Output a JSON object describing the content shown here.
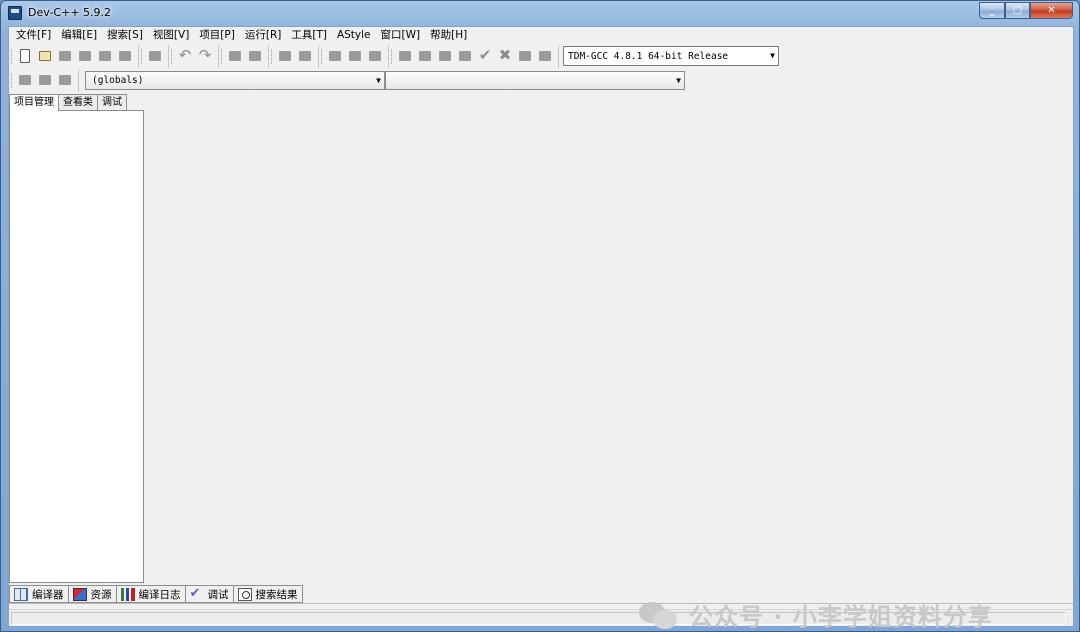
{
  "window": {
    "title": "Dev-C++ 5.9.2"
  },
  "menu": [
    "文件[F]",
    "编辑[E]",
    "搜索[S]",
    "视图[V]",
    "项目[P]",
    "运行[R]",
    "工具[T]",
    "AStyle",
    "窗口[W]",
    "帮助[H]"
  ],
  "toolbar": {
    "compiler": "TDM-GCC 4.8.1 64-bit Release",
    "scope": "(globals)",
    "member": ""
  },
  "left_tabs": [
    "项目管理",
    "查看类",
    "调试"
  ],
  "bottom_tabs": [
    {
      "label": "编译器",
      "icon": "compiler-grid-icon"
    },
    {
      "label": "资源",
      "icon": "resources-icon"
    },
    {
      "label": "编译日志",
      "icon": "chart-icon"
    },
    {
      "label": "调试",
      "icon": "checkmark-icon"
    },
    {
      "label": "搜索结果",
      "icon": "find-icon"
    }
  ],
  "watermark": "公众号 · 小李学姐资料分享"
}
